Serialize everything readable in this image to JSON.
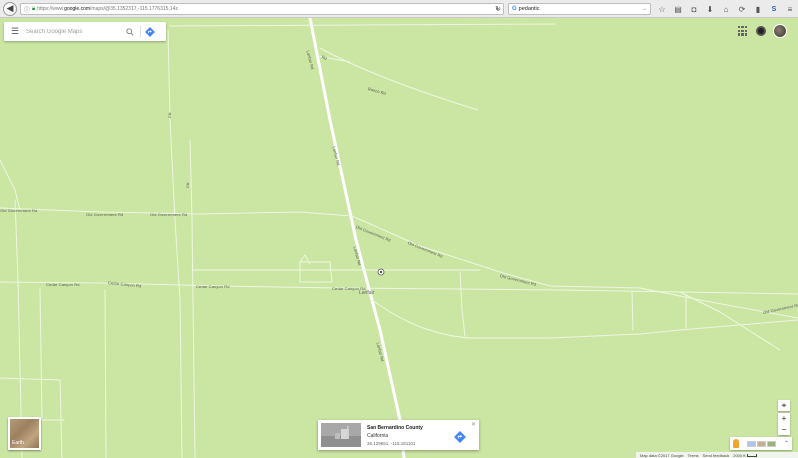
{
  "browser": {
    "url_prefix": "https://www.",
    "url_domain": "google.com",
    "url_path": "/maps/@35.1352317,-115.1776315,14z",
    "search_value": "pedantic"
  },
  "maps": {
    "search_placeholder": "Search Google Maps",
    "place_label": "Lanfair",
    "roads": {
      "old_gov_left": "Old Government Rd",
      "old_gov_mid": "Old Government Rd",
      "old_gov_diag1": "Old Government Rd",
      "old_gov_diag2": "Old Government Rd",
      "old_gov_diag3": "Old Government Rd",
      "old_gov_right": "Old Government Rd",
      "camino_left": "Cedar Canyon Rd",
      "camino_mid1": "Cedar Canyon Rd",
      "camino_mid2": "Cedar Canyon Rd",
      "camino_center": "Cedar Canyon Rd",
      "lanfair_rd_top": "Lanfair Rd",
      "lanfair_rd_mid": "Lanfair Rd",
      "lanfair_rd_low": "Lanfair Rd",
      "lanfair_rd_bottom": "Lanfair Rd",
      "ranch_rd": "Ranch Rd",
      "top_road": "Rd",
      "vertical_left": "Rd",
      "vertical_center": "Rd"
    },
    "earth_label": "Earth",
    "info_card": {
      "title": "San Bernardino County",
      "subtitle": "California",
      "coords": "35.129651, -115.181101"
    },
    "zoom_in_label": "+",
    "zoom_out_label": "−",
    "footer": {
      "map_data": "Map data ©2017 Google",
      "terms": "Terms",
      "feedback": "Send feedback",
      "scale": "2000 ft"
    }
  },
  "colors": {
    "map_background": "#cbe6a3",
    "road": "#ffffff",
    "accent": "#4285f4"
  }
}
